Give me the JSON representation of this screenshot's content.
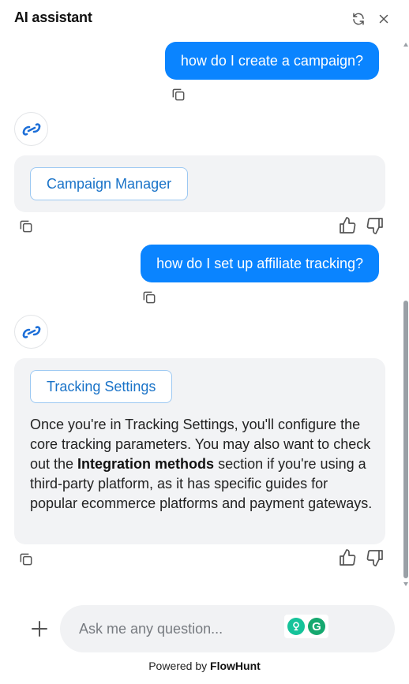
{
  "header": {
    "title": "AI assistant",
    "refresh_icon": "refresh-icon",
    "close_icon": "close-icon"
  },
  "messages": [
    {
      "role": "user",
      "text": "how do I create a campaign?"
    },
    {
      "role": "assistant",
      "link_label": "Campaign Manager",
      "text_html": ""
    },
    {
      "role": "user",
      "text": "how do I set up affiliate tracking?"
    },
    {
      "role": "assistant",
      "link_label": "Tracking Settings",
      "text_before": "Once you're in Tracking Settings, you'll configure the core tracking parameters. You may also want to check out the ",
      "text_bold": "Integration methods",
      "text_after": " section if you're using a third-party platform, as it has specific guides for popular ecommerce platforms and payment gateways."
    }
  ],
  "composer": {
    "placeholder": "Ask me any question...",
    "value": ""
  },
  "footer": {
    "prefix": "Powered by",
    "brand": "FlowHunt"
  },
  "colors": {
    "user_bubble": "#0a84ff",
    "bot_card": "#f2f3f5",
    "link_text": "#1a73c8",
    "brand_logo": "#1d6fd8"
  }
}
